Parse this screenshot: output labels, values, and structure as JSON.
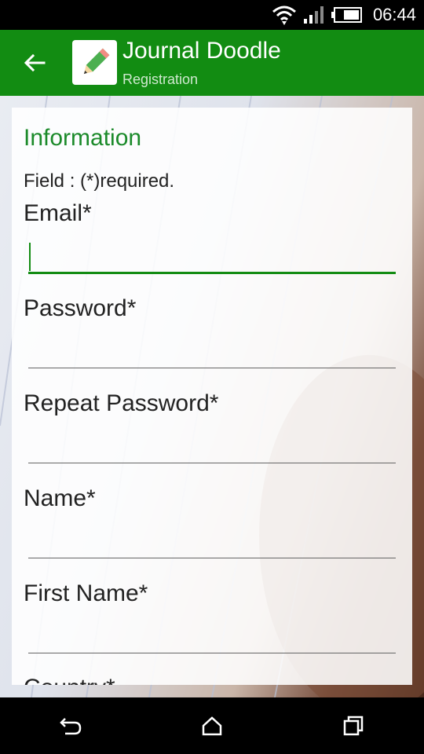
{
  "status_bar": {
    "time": "06:44",
    "icons": [
      "wifi-icon",
      "signal-icon",
      "battery-icon"
    ]
  },
  "app_bar": {
    "title": "Journal Doodle",
    "subtitle": "Registration",
    "icons": [
      "back-arrow-icon",
      "pencil-icon"
    ]
  },
  "form": {
    "section_title": "Information",
    "required_note": "Field : (*)required.",
    "fields": [
      {
        "label": "Email*",
        "value": "",
        "focused": true
      },
      {
        "label": "Password*",
        "value": ""
      },
      {
        "label": "Repeat Password*",
        "value": ""
      },
      {
        "label": "Name*",
        "value": ""
      },
      {
        "label": "First Name*",
        "value": ""
      },
      {
        "label": "Country*",
        "value": ""
      }
    ]
  },
  "colors": {
    "accent": "#138c13",
    "app_bar": "#128c12",
    "section_title": "#1b8a2a"
  },
  "nav_bar": {
    "icons": [
      "back-icon",
      "home-icon",
      "recents-icon"
    ]
  }
}
